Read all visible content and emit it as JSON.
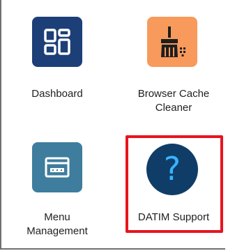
{
  "apps": [
    {
      "id": "dashboard",
      "label": "Dashboard",
      "icon": "dashboard-grid-icon",
      "color": "#1d3f78"
    },
    {
      "id": "browser_cache_cleaner",
      "label_line1": "Browser Cache",
      "label_line2": "Cleaner",
      "icon": "broom-icon",
      "color": "#f79a5b"
    },
    {
      "id": "menu_management",
      "label_line1": "Menu",
      "label_line2": "Management",
      "icon": "window-menu-icon",
      "color": "#3e7d9d"
    },
    {
      "id": "datim_support",
      "label": "DATIM Support",
      "icon": "question-mark-icon",
      "glyph": "?",
      "color": "#0f3d68",
      "highlighted": true
    }
  ],
  "colors": {
    "highlight_border": "#e8141f",
    "question_mark": "#38b3ff"
  }
}
